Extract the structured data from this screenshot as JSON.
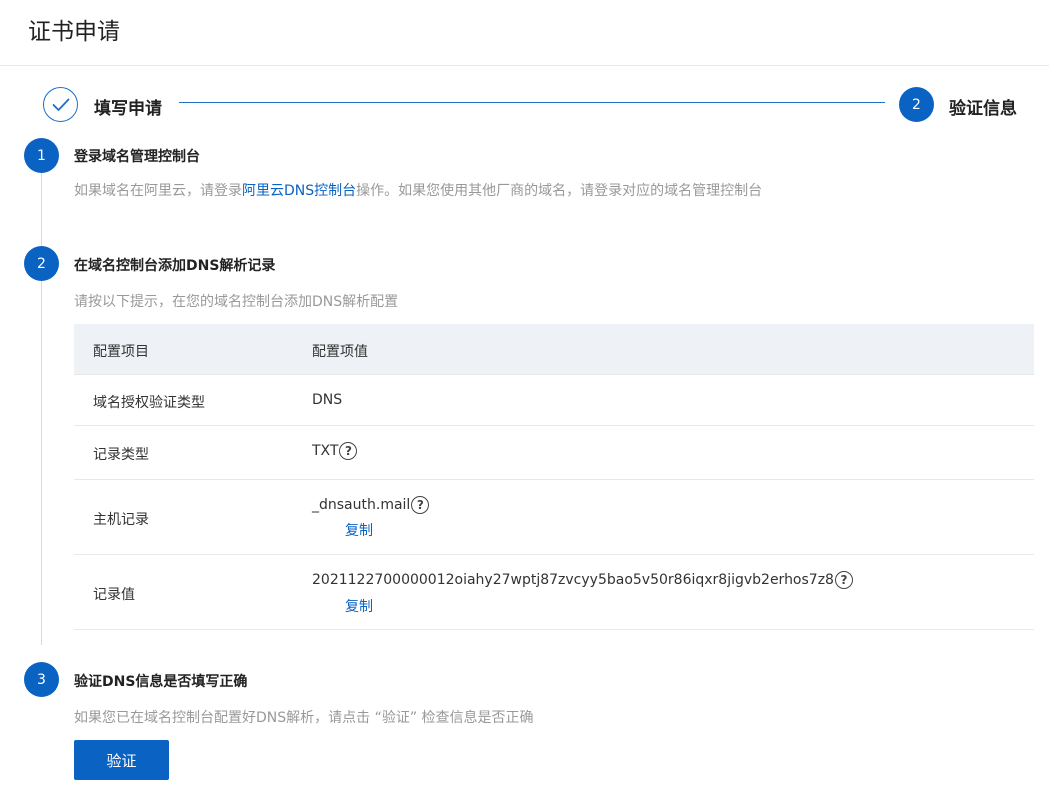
{
  "page": {
    "title": "证书申请"
  },
  "steps": [
    {
      "label": "填写申请",
      "status": "done"
    },
    {
      "number": "2",
      "label": "验证信息",
      "status": "active"
    }
  ],
  "sections": [
    {
      "number": "1",
      "title": "登录域名管理控制台",
      "desc_before": "如果域名在阿里云，请登录",
      "link": "阿里云DNS控制台",
      "desc_after": "操作。如果您使用其他厂商的域名，请登录对应的域名管理控制台"
    },
    {
      "number": "2",
      "title": "在域名控制台添加DNS解析记录",
      "desc": "请按以下提示，在您的域名控制台添加DNS解析配置"
    },
    {
      "number": "3",
      "title": "验证DNS信息是否填写正确",
      "desc": "如果您已在域名控制台配置好DNS解析，请点击 “验证” 检查信息是否正确"
    }
  ],
  "table": {
    "headers": [
      "配置项目",
      "配置项值"
    ],
    "rows": [
      {
        "key": "域名授权验证类型",
        "value": "DNS"
      },
      {
        "key": "记录类型",
        "value": "TXT",
        "help": "?"
      },
      {
        "key": "主机记录",
        "value": "_dnsauth.mail",
        "help": "?",
        "action": "复制"
      },
      {
        "key": "记录值",
        "value": "2021122700000012oiahy27wptj87zvcyy5bao5v50r86iqxr8jigvb2erhos7z8",
        "help": "?",
        "action": "复制"
      }
    ]
  },
  "verify_button": "验证",
  "colors": {
    "primary": "#0a62c2",
    "header_bg": "#eef1f6",
    "muted_text": "#999999"
  }
}
